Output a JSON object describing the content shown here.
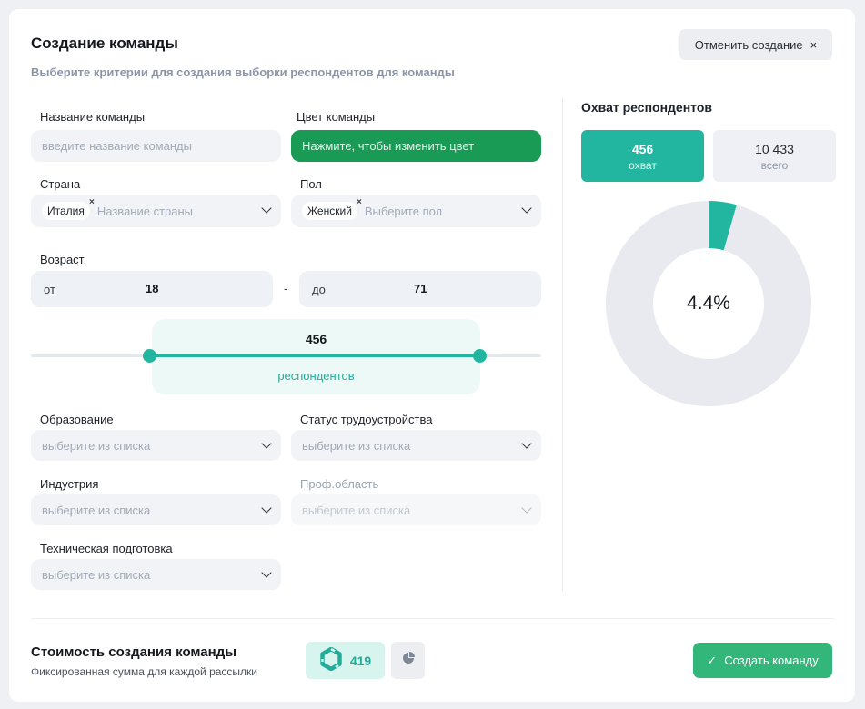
{
  "header": {
    "title": "Создание команды",
    "subtitle": "Выберите критерии для создания выборки респондентов для команды",
    "cancel_label": "Отменить создание",
    "cancel_icon": "×"
  },
  "form": {
    "team_name": {
      "label": "Название команды",
      "placeholder": "введите название команды",
      "value": ""
    },
    "team_color": {
      "label": "Цвет команды",
      "button_label": "Нажмите, чтобы изменить цвет",
      "color": "#1a9b55"
    },
    "country": {
      "label": "Страна",
      "tag": "Италия",
      "placeholder": "Название страны"
    },
    "gender": {
      "label": "Пол",
      "tag": "Женский",
      "placeholder": "Выберите пол"
    },
    "age": {
      "label": "Возраст",
      "from_prefix": "от",
      "from_value": "18",
      "separator": "-",
      "to_prefix": "до",
      "to_value": "71"
    },
    "education": {
      "label": "Образование",
      "placeholder": "выберите из списка"
    },
    "employment": {
      "label": "Статус трудоустройства",
      "placeholder": "выберите из списка"
    },
    "industry": {
      "label": "Индустрия",
      "placeholder": "выберите из списка"
    },
    "prof_area": {
      "label": "Проф.область",
      "placeholder": "выберите из списка",
      "disabled": true
    },
    "tech": {
      "label": "Техническая подготовка",
      "placeholder": "выберите из списка"
    }
  },
  "slider": {
    "count": "456",
    "unit": "респондентов",
    "min": 18,
    "max": 71
  },
  "reach": {
    "title": "Охват респондентов",
    "reach_value": "456",
    "reach_caption": "охват",
    "total_value": "10 433",
    "total_caption": "всего",
    "percent_label": "4.4%",
    "fraction": 0.044,
    "accent": "#22b6a0",
    "rest_color": "#e9eaf0"
  },
  "footer": {
    "cost_title": "Стоимость создания команды",
    "cost_subtitle": "Фиксированная сумма для каждой рассылки",
    "price": "419",
    "create_label": "Создать команду",
    "create_icon": "✓"
  }
}
